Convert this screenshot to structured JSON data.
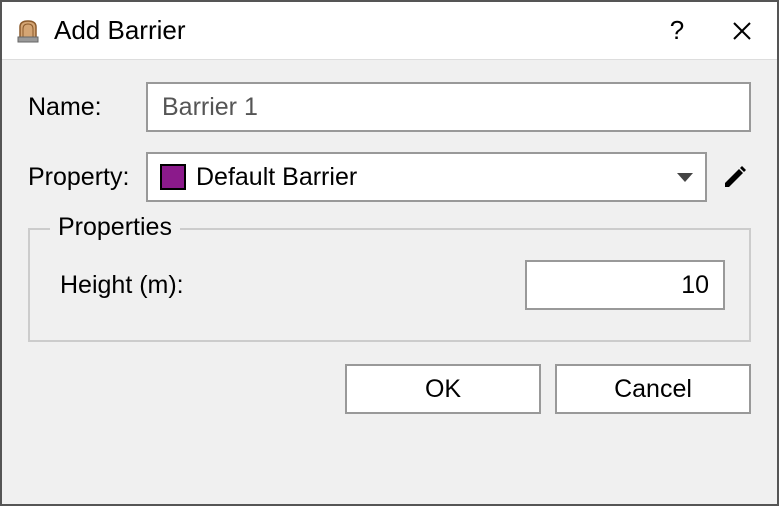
{
  "titlebar": {
    "title": "Add Barrier",
    "help": "?"
  },
  "form": {
    "name_label": "Name:",
    "name_value": "Barrier 1",
    "property_label": "Property:",
    "property_selected": "Default Barrier",
    "property_swatch_color": "#8b1a8b"
  },
  "properties": {
    "legend": "Properties",
    "height_label": "Height (m):",
    "height_value": "10"
  },
  "buttons": {
    "ok": "OK",
    "cancel": "Cancel"
  }
}
